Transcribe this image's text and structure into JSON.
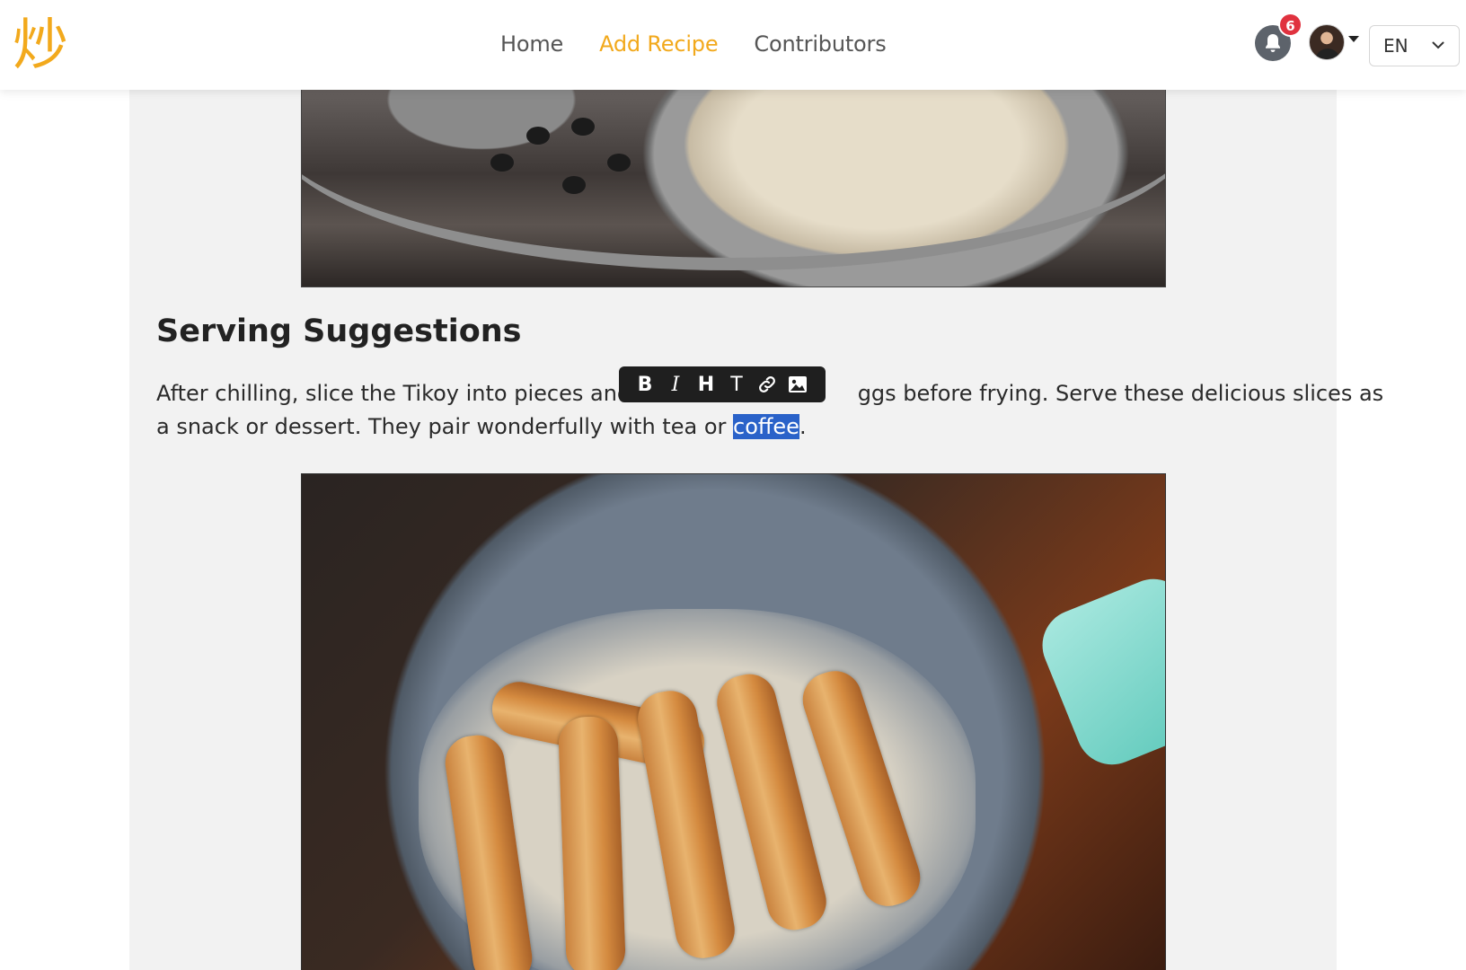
{
  "app": {
    "logo_char": "炒"
  },
  "nav": {
    "links": [
      {
        "label": "Home",
        "active": false
      },
      {
        "label": "Add Recipe",
        "active": true
      },
      {
        "label": "Contributors",
        "active": false
      }
    ]
  },
  "header_actions": {
    "notifications_count": "6",
    "language": "EN"
  },
  "colors": {
    "accent": "#f2a91c",
    "badge": "#e0323f",
    "selection": "#2a62c9",
    "panel_bg": "#f2f2f2"
  },
  "content": {
    "section_heading": "Serving Suggestions",
    "paragraph_line1_before": "After chilling, slice the Tikoy into pieces and di",
    "paragraph_line1_after": "ggs before frying. Serve these delicious slices as",
    "paragraph_line2_before": "a snack or dessert. They pair wonderfully with tea or ",
    "paragraph_line2_selected": "coffee",
    "paragraph_line2_after": "."
  },
  "format_toolbar": {
    "bold": "B",
    "italic": "I",
    "heading": "H",
    "text": "T",
    "icons": [
      "link-icon",
      "image-icon"
    ]
  }
}
